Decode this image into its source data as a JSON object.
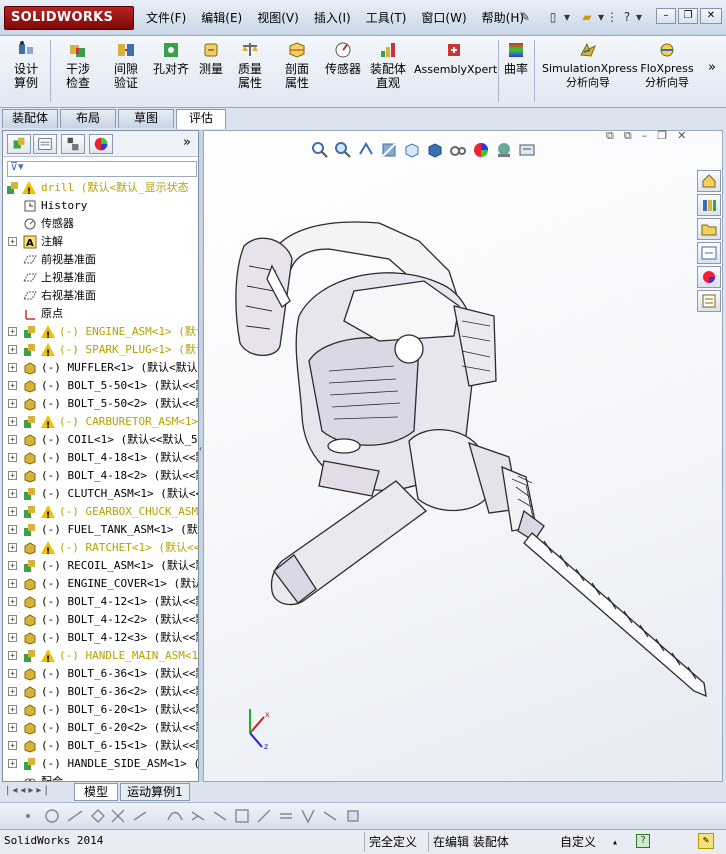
{
  "app": {
    "logo_text": "SOLIDWORKS",
    "menus": [
      "文件(F)",
      "编辑(E)",
      "视图(V)",
      "插入(I)",
      "工具(T)",
      "窗口(W)",
      "帮助(H)"
    ]
  },
  "ribbon": {
    "buttons": [
      {
        "label": "设计算例",
        "icon": "design-study-icon"
      },
      {
        "label": "干涉检查",
        "icon": "interference-icon"
      },
      {
        "label": "间隙验证",
        "icon": "clearance-icon"
      },
      {
        "label": "孔对齐",
        "icon": "hole-align-icon"
      },
      {
        "label": "测量",
        "icon": "measure-icon"
      },
      {
        "label": "质量属性",
        "icon": "mass-props-icon"
      },
      {
        "label": "剖面属性",
        "icon": "section-props-icon"
      },
      {
        "label": "传感器",
        "icon": "sensor-icon"
      },
      {
        "label": "装配体直观",
        "icon": "assembly-visual-icon"
      },
      {
        "label": "AssemblyXpert",
        "icon": "assemblyxpert-icon"
      },
      {
        "label": "曲率",
        "icon": "curvature-icon"
      },
      {
        "label": "SimulationXpress分析向导",
        "icon": "simxpress-icon"
      },
      {
        "label": "FloXpress分析向导",
        "icon": "floxpress-icon"
      }
    ]
  },
  "cmd_tabs": [
    "装配体",
    "布局",
    "草图",
    "评估"
  ],
  "active_cmd_tab": "评估",
  "tree": {
    "root": "drill  (默认<默认_显示状态",
    "items": [
      {
        "label": "History",
        "icon": "history-icon",
        "expand": false,
        "warn": false,
        "dim": false
      },
      {
        "label": "传感器",
        "icon": "sensor-icon",
        "expand": false,
        "warn": false,
        "dim": false
      },
      {
        "label": "注解",
        "icon": "annotation-icon",
        "expand": true,
        "warn": false,
        "dim": false
      },
      {
        "label": "前视基准面",
        "icon": "plane-icon",
        "expand": false,
        "warn": false,
        "dim": false
      },
      {
        "label": "上视基准面",
        "icon": "plane-icon",
        "expand": false,
        "warn": false,
        "dim": false
      },
      {
        "label": "右视基准面",
        "icon": "plane-icon",
        "expand": false,
        "warn": false,
        "dim": false
      },
      {
        "label": "原点",
        "icon": "origin-icon",
        "expand": false,
        "warn": false,
        "dim": false
      },
      {
        "label": "(-) ENGINE_ASM<1> (默认",
        "icon": "assembly-icon",
        "expand": true,
        "warn": true,
        "dim": true
      },
      {
        "label": "(-) SPARK_PLUG<1> (默认",
        "icon": "assembly-icon",
        "expand": true,
        "warn": true,
        "dim": true
      },
      {
        "label": "(-) MUFFLER<1> (默认<默认",
        "icon": "part-icon",
        "expand": true,
        "warn": false,
        "dim": false
      },
      {
        "label": "(-) BOLT_5-50<1> (默认<<默",
        "icon": "part-icon",
        "expand": true,
        "warn": false,
        "dim": false
      },
      {
        "label": "(-) BOLT_5-50<2> (默认<<默",
        "icon": "part-icon",
        "expand": true,
        "warn": false,
        "dim": false
      },
      {
        "label": "(-) CARBURETOR_ASM<1> (",
        "icon": "assembly-icon",
        "expand": true,
        "warn": true,
        "dim": true
      },
      {
        "label": "(-) COIL<1> (默认<<默认_5",
        "icon": "part-icon",
        "expand": true,
        "warn": false,
        "dim": false
      },
      {
        "label": "(-) BOLT_4-18<1> (默认<<默",
        "icon": "part-icon",
        "expand": true,
        "warn": false,
        "dim": false
      },
      {
        "label": "(-) BOLT_4-18<2> (默认<<默",
        "icon": "part-icon",
        "expand": true,
        "warn": false,
        "dim": false
      },
      {
        "label": "(-) CLUTCH_ASM<1> (默认<<",
        "icon": "assembly-icon",
        "expand": true,
        "warn": false,
        "dim": false
      },
      {
        "label": "(-) GEARBOX_CHUCK_ASM<1",
        "icon": "assembly-icon",
        "expand": true,
        "warn": true,
        "dim": true
      },
      {
        "label": "(-) FUEL_TANK_ASM<1> (默",
        "icon": "assembly-icon",
        "expand": true,
        "warn": false,
        "dim": false
      },
      {
        "label": "(-) RATCHET<1> (默认<<默",
        "icon": "part-icon",
        "expand": true,
        "warn": true,
        "dim": true
      },
      {
        "label": "(-) RECOIL_ASM<1> (默认<默",
        "icon": "assembly-icon",
        "expand": true,
        "warn": false,
        "dim": false
      },
      {
        "label": "(-) ENGINE_COVER<1> (默认<",
        "icon": "part-icon",
        "expand": true,
        "warn": false,
        "dim": false
      },
      {
        "label": "(-) BOLT_4-12<1> (默认<<默",
        "icon": "part-icon",
        "expand": true,
        "warn": false,
        "dim": false
      },
      {
        "label": "(-) BOLT_4-12<2> (默认<<默",
        "icon": "part-icon",
        "expand": true,
        "warn": false,
        "dim": false
      },
      {
        "label": "(-) BOLT_4-12<3> (默认<<默",
        "icon": "part-icon",
        "expand": true,
        "warn": false,
        "dim": false
      },
      {
        "label": "(-) HANDLE_MAIN_ASM<1> (",
        "icon": "assembly-icon",
        "expand": true,
        "warn": true,
        "dim": true
      },
      {
        "label": "(-) BOLT_6-36<1> (默认<<默",
        "icon": "part-icon",
        "expand": true,
        "warn": false,
        "dim": false
      },
      {
        "label": "(-) BOLT_6-36<2> (默认<<默",
        "icon": "part-icon",
        "expand": true,
        "warn": false,
        "dim": false
      },
      {
        "label": "(-) BOLT_6-20<1> (默认<<默",
        "icon": "part-icon",
        "expand": true,
        "warn": false,
        "dim": false
      },
      {
        "label": "(-) BOLT_6-20<2> (默认<<默",
        "icon": "part-icon",
        "expand": true,
        "warn": false,
        "dim": false
      },
      {
        "label": "(-) BOLT_6-15<1> (默认<<默",
        "icon": "part-icon",
        "expand": true,
        "warn": false,
        "dim": false
      },
      {
        "label": "(-) HANDLE_SIDE_ASM<1> (默",
        "icon": "assembly-icon",
        "expand": true,
        "warn": false,
        "dim": false
      },
      {
        "label": "配合",
        "icon": "mates-icon",
        "expand": false,
        "warn": false,
        "dim": false
      }
    ]
  },
  "bottom_tabs": [
    "模型",
    "运动算例1"
  ],
  "status": {
    "app_version": "SolidWorks 2014",
    "constraint": "完全定义",
    "editing": "在编辑 装配体",
    "units": "自定义"
  },
  "colors": {
    "brand": "#9e1414",
    "accent": "#3a6fb0",
    "warning": "#f0c000"
  }
}
